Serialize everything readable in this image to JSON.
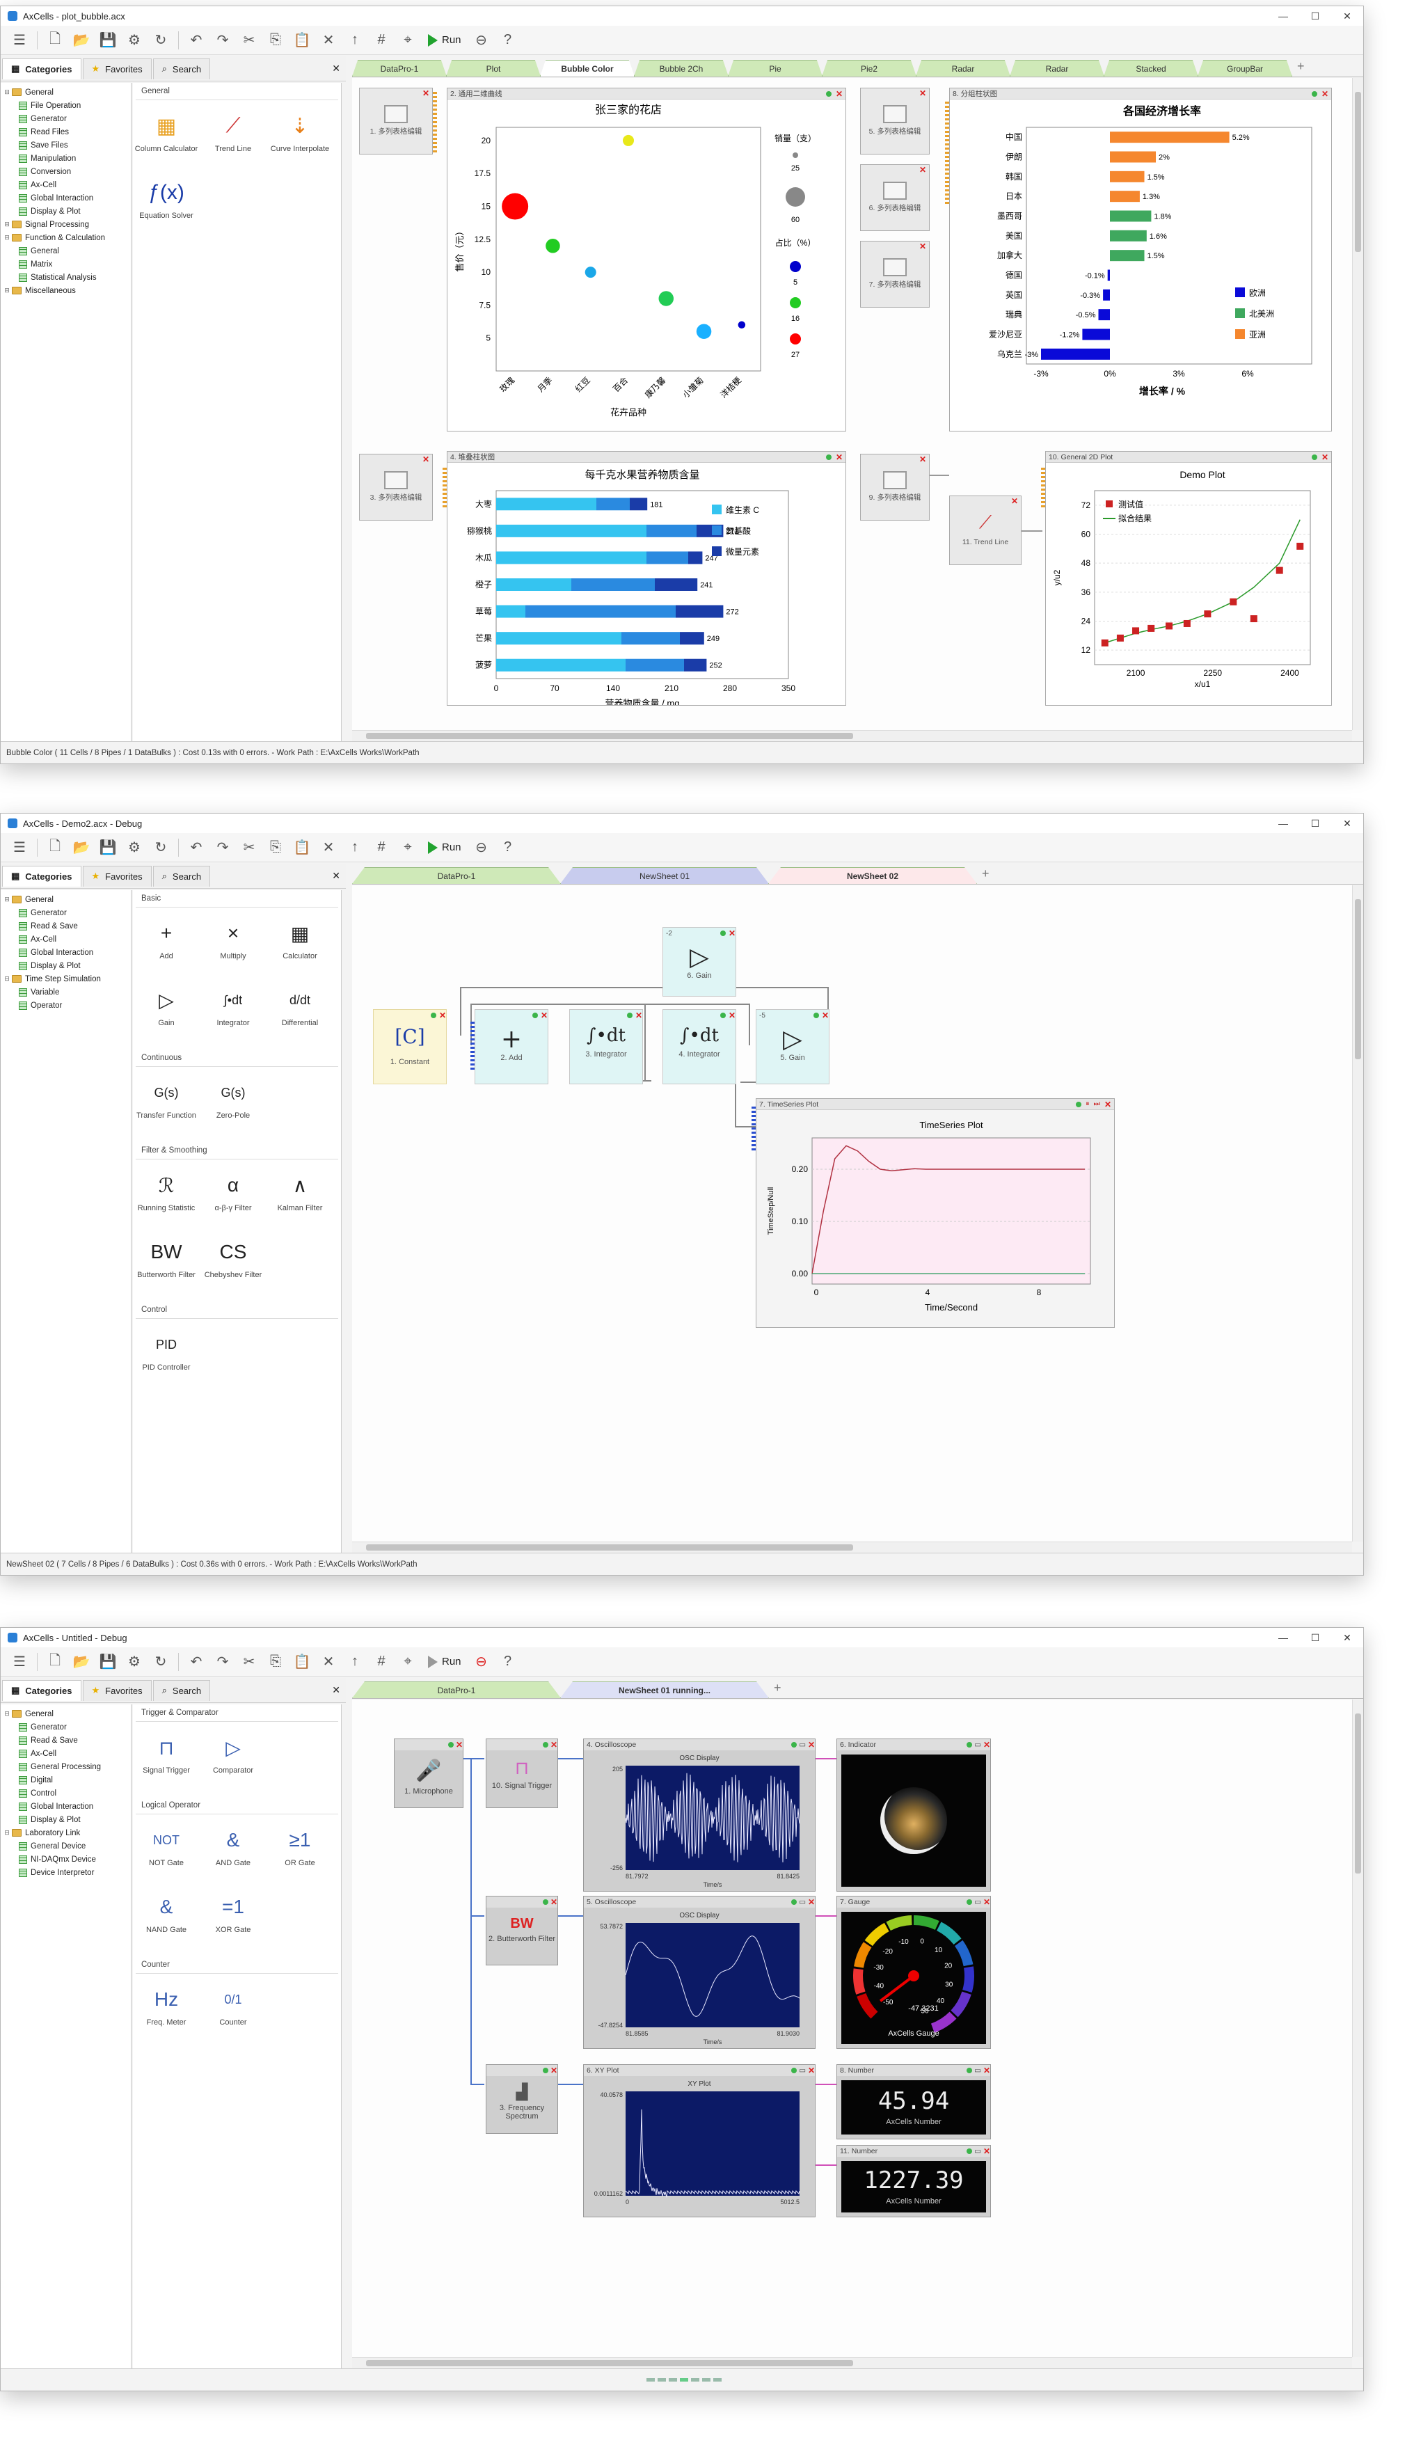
{
  "windows": [
    {
      "title": "AxCells - plot_bubble.acx",
      "status": "Bubble Color ( 11 Cells / 8 Pipes / 1 DataBulks ) : Cost 0.13s with 0 errors. - Work Path : E:\\AxCells Works\\WorkPath",
      "left_tabs": {
        "categories": "Categories",
        "favorites": "Favorites",
        "search": "Search"
      },
      "run_label": "Run",
      "doc_tabs": [
        "DataPro-1",
        "Plot",
        "Bubble Color",
        "Bubble 2Ch",
        "Pie",
        "Pie2",
        "Radar",
        "Radar",
        "Stacked",
        "GroupBar"
      ],
      "active_tab": "Bubble Color",
      "tree": [
        {
          "label": "General",
          "type": "folder",
          "level": 0
        },
        {
          "label": "File Operation",
          "type": "grid",
          "level": 1
        },
        {
          "label": "Generator",
          "type": "grid",
          "level": 1
        },
        {
          "label": "Read Files",
          "type": "grid",
          "level": 1
        },
        {
          "label": "Save Files",
          "type": "grid",
          "level": 1
        },
        {
          "label": "Manipulation",
          "type": "grid",
          "level": 1
        },
        {
          "label": "Conversion",
          "type": "grid",
          "level": 1
        },
        {
          "label": "Ax-Cell",
          "type": "grid",
          "level": 1
        },
        {
          "label": "Global Interaction",
          "type": "grid",
          "level": 1
        },
        {
          "label": "Display & Plot",
          "type": "grid",
          "level": 1
        },
        {
          "label": "Signal Processing",
          "type": "folder",
          "level": 0
        },
        {
          "label": "Function & Calculation",
          "type": "folder",
          "level": 0
        },
        {
          "label": "General",
          "type": "grid",
          "level": 1
        },
        {
          "label": "Matrix",
          "type": "grid",
          "level": 1
        },
        {
          "label": "Statistical Analysis",
          "type": "grid",
          "level": 1
        },
        {
          "label": "Miscellaneous",
          "type": "folder",
          "level": 0
        }
      ],
      "palette": {
        "section": "General",
        "items": [
          {
            "label": "Column Calculator",
            "icon": "column-calculator-icon"
          },
          {
            "label": "Trend Line",
            "icon": "trend-line-icon"
          },
          {
            "label": "Curve Interpolate",
            "icon": "curve-interpolate-icon"
          },
          {
            "label": "Equation Solver",
            "icon": "equation-solver-icon"
          }
        ]
      },
      "cells": {
        "c1": "1. 多列表格编辑",
        "c2": "2. 通用二维曲线",
        "c3": "3. 多列表格编辑",
        "c4": "4. 堆叠柱状图",
        "c5": "5. 多列表格编辑",
        "c6": "6. 多列表格编辑",
        "c7": "7. 多列表格编辑",
        "c8": "8. 分组柱状图",
        "c9": "9. 多列表格编辑",
        "c10": "10. General 2D Plot",
        "c11": "11. Trend Line"
      }
    },
    {
      "title": "AxCells - Demo2.acx - Debug",
      "status": "NewSheet 02 ( 7 Cells / 8 Pipes / 6 DataBulks ) : Cost 0.36s with 0 errors. - Work Path : E:\\AxCells Works\\WorkPath",
      "doc_tabs": [
        "DataPro-1",
        "NewSheet 01",
        "NewSheet 02"
      ],
      "active_tab": "NewSheet 02",
      "tree": [
        {
          "label": "General",
          "type": "folder",
          "level": 0
        },
        {
          "label": "Generator",
          "type": "grid",
          "level": 1
        },
        {
          "label": "Read & Save",
          "type": "grid",
          "level": 1
        },
        {
          "label": "Ax-Cell",
          "type": "grid",
          "level": 1
        },
        {
          "label": "Global Interaction",
          "type": "grid",
          "level": 1
        },
        {
          "label": "Display & Plot",
          "type": "grid",
          "level": 1
        },
        {
          "label": "Time Step Simulation",
          "type": "folder",
          "level": 0
        },
        {
          "label": "Variable",
          "type": "grid",
          "level": 1
        },
        {
          "label": "Operator",
          "type": "grid",
          "level": 1
        }
      ],
      "palette_sections": [
        {
          "section": "Basic",
          "items": [
            {
              "label": "Add",
              "sym": "+"
            },
            {
              "label": "Multiply",
              "sym": "×"
            },
            {
              "label": "Calculator",
              "sym": "▦"
            },
            {
              "label": "Gain",
              "sym": "▷"
            },
            {
              "label": "Integrator",
              "sym": "∫•dt"
            },
            {
              "label": "Differential",
              "sym": "d/dt"
            }
          ]
        },
        {
          "section": "Continuous",
          "items": [
            {
              "label": "Transfer Function",
              "sym": "G(s)"
            },
            {
              "label": "Zero-Pole",
              "sym": "G(s)"
            }
          ]
        },
        {
          "section": "Filter & Smoothing",
          "items": [
            {
              "label": "Running Statistic",
              "sym": "ℛ"
            },
            {
              "label": "α-β-γ Filter",
              "sym": "α"
            },
            {
              "label": "Kalman Filter",
              "sym": "∧"
            },
            {
              "label": "Butterworth Filter",
              "sym": "BW"
            },
            {
              "label": "Chebyshev Filter",
              "sym": "CS"
            }
          ]
        },
        {
          "section": "Control",
          "items": [
            {
              "label": "PID Controller",
              "sym": "PID"
            }
          ]
        }
      ],
      "blocks": {
        "b1": "1. Constant",
        "b1sym": "[C]",
        "b2": "2. Add",
        "b2sym": "+",
        "b3": "3. Integrator",
        "b3sym": "∫•dt",
        "b4": "4. Integrator",
        "b4sym": "∫•dt",
        "b5": "5. Gain",
        "b5val": "-5",
        "b5sym": "▷",
        "b6": "6. Gain",
        "b6val": "-2",
        "b6sym": "▷",
        "b7": "7. TimeSeries Plot"
      }
    },
    {
      "title": "AxCells - Untitled - Debug",
      "doc_tabs": [
        "DataPro-1",
        "NewSheet 01 running..."
      ],
      "active_tab": "NewSheet 01 running...",
      "tree": [
        {
          "label": "General",
          "type": "folder",
          "level": 0
        },
        {
          "label": "Generator",
          "type": "grid",
          "level": 1
        },
        {
          "label": "Read & Save",
          "type": "grid",
          "level": 1
        },
        {
          "label": "Ax-Cell",
          "type": "grid",
          "level": 1
        },
        {
          "label": "General Processing",
          "type": "grid",
          "level": 1
        },
        {
          "label": "Digital",
          "type": "grid",
          "level": 1
        },
        {
          "label": "Control",
          "type": "grid",
          "level": 1
        },
        {
          "label": "Global Interaction",
          "type": "grid",
          "level": 1
        },
        {
          "label": "Display & Plot",
          "type": "grid",
          "level": 1
        },
        {
          "label": "Laboratory Link",
          "type": "folder",
          "level": 0
        },
        {
          "label": "General Device",
          "type": "grid",
          "level": 1
        },
        {
          "label": "NI-DAQmx Device",
          "type": "grid",
          "level": 1
        },
        {
          "label": "Device Interpretor",
          "type": "grid",
          "level": 1
        }
      ],
      "palette_sections": [
        {
          "section": "Trigger & Comparator",
          "items": [
            {
              "label": "Signal Trigger",
              "sym": "⊓"
            },
            {
              "label": "Comparator",
              "sym": "▷"
            }
          ]
        },
        {
          "section": "Logical Operator",
          "items": [
            {
              "label": "NOT Gate",
              "sym": "NOT"
            },
            {
              "label": "AND Gate",
              "sym": "&"
            },
            {
              "label": "OR Gate",
              "sym": "≥1"
            },
            {
              "label": "NAND Gate",
              "sym": "&"
            },
            {
              "label": "XOR Gate",
              "sym": "=1"
            }
          ]
        },
        {
          "section": "Counter",
          "items": [
            {
              "label": "Freq. Meter",
              "sym": "Hz"
            },
            {
              "label": "Counter",
              "sym": "0/1"
            }
          ]
        }
      ],
      "devices": {
        "d1": "1. Microphone",
        "d2": "2. Butterworth Filter",
        "d3": "3. Frequency Spectrum",
        "d10": "10. Signal Trigger",
        "d4": "4. Oscilloscope",
        "d5": "5. Oscilloscope",
        "d6": "6. XY Plot",
        "d8i": "6. Indicator",
        "d7": "7. Gauge",
        "d8": "8. Number",
        "d11": "11. Number",
        "osc1_title": "OSC Display",
        "osc1_ymax": "205",
        "osc1_ymin": "-256",
        "osc1_xmin": "81.7972",
        "osc1_xmax": "81.8425",
        "osc1_xl": "Time/s",
        "osc2_title": "OSC Display",
        "osc2_ymax": "53.7872",
        "osc2_ymin": "-47.8254",
        "osc2_xmin": "81.8585",
        "osc2_xmax": "81.9030",
        "osc2_xl": "Time/s",
        "xy_title": "XY Plot",
        "xy_ymax": "40.0578",
        "xy_ymin": "0.0011162",
        "xy_xmin": "0",
        "xy_xmax": "5012.5",
        "gauge_label": "AxCells Gauge",
        "gauge_value": "-47.3231",
        "num1": "45.94",
        "num1_label": "AxCells Number",
        "num2": "1227.39",
        "num2_label": "AxCells Number"
      }
    }
  ],
  "chart_data": [
    {
      "type": "scatter",
      "title": "张三家的花店",
      "xlabel": "花卉品种",
      "ylabel": "售价（元）",
      "categories": [
        "玫瑰",
        "月季",
        "红豆",
        "百合",
        "康乃馨",
        "小雏菊",
        "洋桔梗"
      ],
      "ylim": [
        2.5,
        21
      ],
      "yticks": [
        5,
        7.5,
        10,
        12.5,
        15,
        17.5,
        20
      ],
      "values": [
        15,
        12,
        10,
        20,
        8,
        5.5,
        6
      ],
      "sizes": [
        60,
        25,
        16,
        16,
        27,
        27,
        5
      ],
      "colors": [
        "#ff0000",
        "#22cc22",
        "#1aa7e8",
        "#e8e81a",
        "#22cc55",
        "#1ab0ff",
        "#0000cc"
      ],
      "legend": {
        "size_title": "销量（支）",
        "size_values": [
          "25",
          "60"
        ],
        "color_title": "占比（%）",
        "color_values": [
          "5",
          "16",
          "27"
        ]
      }
    },
    {
      "type": "bar",
      "title": "各国经济增长率",
      "xlabel": "增长率 / %",
      "categories": [
        "中国",
        "伊朗",
        "韩国",
        "日本",
        "墨西哥",
        "美国",
        "加拿大",
        "德国",
        "英国",
        "瑞典",
        "爱沙尼亚",
        "乌克兰"
      ],
      "values": [
        5.2,
        2,
        1.5,
        1.3,
        1.8,
        1.6,
        1.5,
        -0.1,
        -0.3,
        -0.5,
        -1.2,
        -3
      ],
      "labels": [
        "5.2%",
        "2%",
        "1.5%",
        "1.3%",
        "1.8%",
        "1.6%",
        "1.5%",
        "-0.1%",
        "-0.3%",
        "-0.5%",
        "-1.2%",
        "-3%"
      ],
      "groups": [
        "亚洲",
        "亚洲",
        "亚洲",
        "亚洲",
        "北美洲",
        "北美洲",
        "北美洲",
        "欧洲",
        "欧洲",
        "欧洲",
        "欧洲",
        "欧洲"
      ],
      "xticks": [
        "-3%",
        "0%",
        "3%",
        "6%"
      ],
      "legend": [
        {
          "name": "欧洲",
          "color": "#0a0ad8"
        },
        {
          "name": "北美洲",
          "color": "#3fa85e"
        },
        {
          "name": "亚洲",
          "color": "#f5872e"
        }
      ]
    },
    {
      "type": "bar",
      "title": "每千克水果营养物质含量",
      "xlabel": "营养物质含量 / mg",
      "categories": [
        "大枣",
        "猕猴桃",
        "木瓜",
        "橙子",
        "草莓",
        "芒果",
        "菠萝"
      ],
      "series": [
        {
          "name": "维生素 C",
          "values": [
            120,
            180,
            180,
            90,
            35,
            150,
            155
          ]
        },
        {
          "name": "氨基酸",
          "values": [
            40,
            60,
            50,
            100,
            180,
            70,
            70
          ]
        },
        {
          "name": "微量元素",
          "values": [
            21,
            32,
            17,
            51,
            57,
            29,
            27
          ]
        }
      ],
      "totals": [
        "181",
        "272",
        "247",
        "241",
        "272",
        "249",
        "252"
      ],
      "xticks": [
        "0",
        "70",
        "140",
        "210",
        "280",
        "350"
      ],
      "xlim": [
        0,
        350
      ]
    },
    {
      "type": "scatter",
      "title": "Demo Plot",
      "xlabel": "x/u1",
      "ylabel": "y/u2",
      "x": [
        2040,
        2070,
        2100,
        2130,
        2165,
        2200,
        2240,
        2290,
        2330,
        2380,
        2420
      ],
      "y": [
        15,
        17,
        20,
        21,
        22,
        23,
        27,
        32,
        25,
        45,
        55
      ],
      "fit_y": [
        15,
        17,
        19,
        20.5,
        22,
        24,
        27,
        32,
        38,
        48,
        66
      ],
      "legend": [
        "测试值",
        "拟合结果"
      ],
      "xticks": [
        "2100",
        "2250",
        "2400"
      ],
      "yticks": [
        "12",
        "24",
        "36",
        "48",
        "60",
        "72"
      ]
    },
    {
      "type": "line",
      "title": "TimeSeries Plot",
      "xlabel": "Time/Second",
      "ylabel": "TimeStep/Null",
      "xticks": [
        "0",
        "4",
        "8"
      ],
      "yticks": [
        "0.00",
        "0.10",
        "0.20"
      ],
      "series": [
        {
          "name": "x",
          "values": [
            0,
            0.12,
            0.22,
            0.245,
            0.235,
            0.215,
            0.2,
            0.197,
            0.199,
            0.201,
            0.2,
            0.2,
            0.2,
            0.2,
            0.2,
            0.2,
            0.2,
            0.2,
            0.2,
            0.2,
            0.2,
            0.2,
            0.2,
            0.2,
            0.2
          ]
        },
        {
          "name": "v",
          "values": [
            0,
            0,
            0,
            0,
            0,
            0,
            0,
            0,
            0,
            0,
            0,
            0,
            0,
            0,
            0,
            0,
            0,
            0,
            0,
            0,
            0,
            0,
            0,
            0,
            0
          ]
        }
      ]
    }
  ]
}
